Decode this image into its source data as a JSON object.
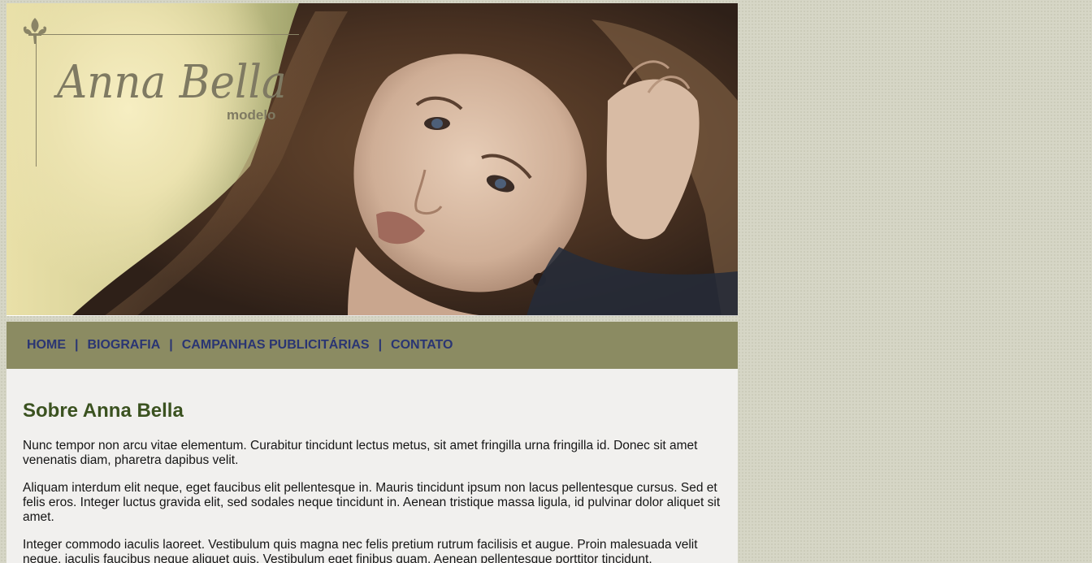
{
  "header": {
    "logo": {
      "name": "Anna Bella",
      "subtitle": "modelo"
    },
    "banner_image": "model-portrait-photo"
  },
  "nav": {
    "items": [
      {
        "label": "HOME"
      },
      {
        "label": "BIOGRAFIA"
      },
      {
        "label": "CAMPANHAS PUBLICITÁRIAS"
      },
      {
        "label": "CONTATO"
      }
    ],
    "separator": "|"
  },
  "main": {
    "title": "Sobre Anna Bella",
    "paragraphs": [
      "Nunc tempor non arcu vitae elementum. Curabitur tincidunt lectus metus, sit amet fringilla urna fringilla id. Donec sit amet venenatis diam, pharetra dapibus velit.",
      "Aliquam interdum elit neque, eget faucibus elit pellentesque in. Mauris tincidunt ipsum non lacus pellentesque cursus. Sed et felis eros. Integer luctus gravida elit, sed sodales neque tincidunt in. Aenean tristique massa ligula, id pulvinar dolor aliquet sit amet.",
      "Integer commodo iaculis laoreet. Vestibulum quis magna nec felis pretium rutrum facilisis et augue. Proin malesuada velit neque, iaculis faucibus neque aliquet quis. Vestibulum eget finibus quam. Aenean pellentesque porttitor tincidunt."
    ]
  },
  "colors": {
    "page_background": "#d6d6c6",
    "nav_background": "#8b8b62",
    "nav_link": "#2a3573",
    "content_background": "#f1f0ee",
    "title": "#3b5220",
    "logo": "#7f7a62"
  }
}
